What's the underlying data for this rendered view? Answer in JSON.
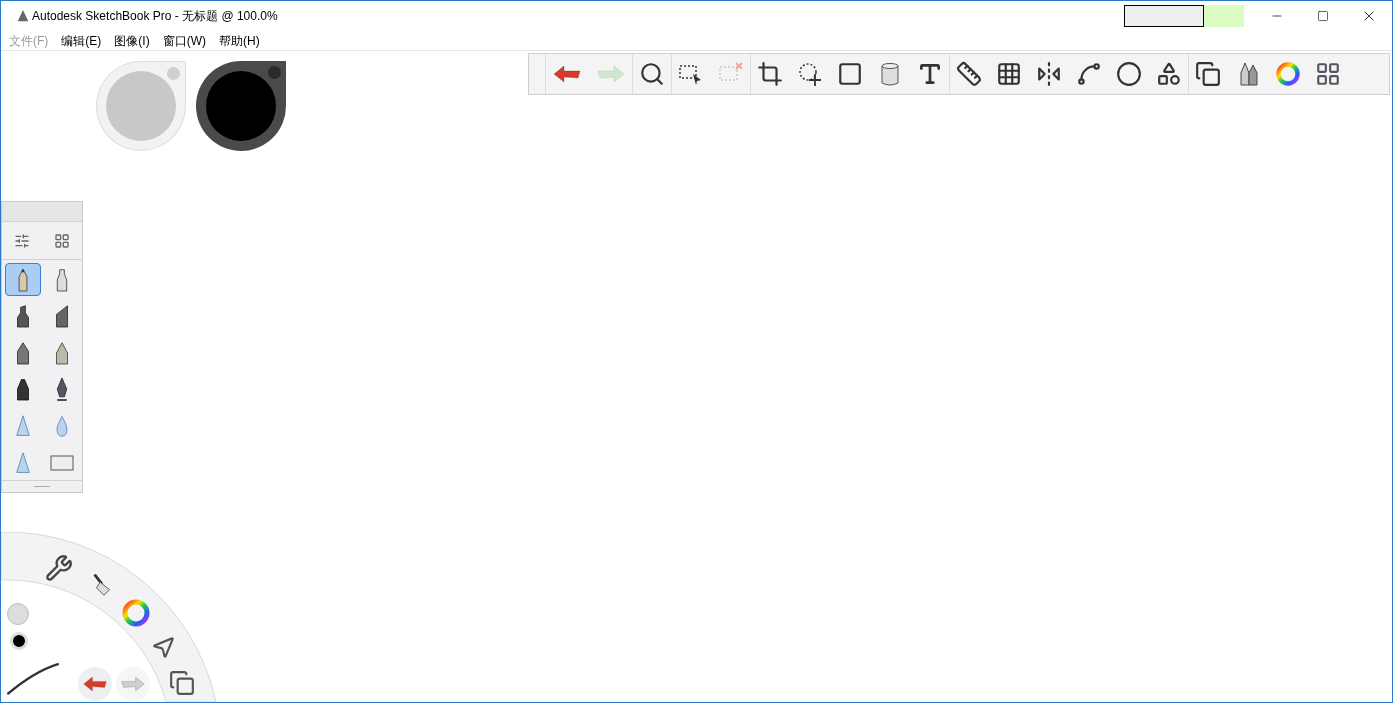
{
  "window": {
    "title": "Autodesk SketchBook Pro - 无标题 @ 100.0%"
  },
  "menu": [
    {
      "label": "文件(F)"
    },
    {
      "label": "编辑(E)"
    },
    {
      "label": "图像(I)"
    },
    {
      "label": "窗口(W)"
    },
    {
      "label": "帮助(H)"
    }
  ],
  "pucks": [
    {
      "color": "#c8c8c8"
    },
    {
      "color": "#000000"
    }
  ],
  "toolbar": {
    "groups": [
      [
        {
          "kind": "undo",
          "disabled": false
        },
        {
          "kind": "redo",
          "disabled": true
        }
      ],
      [
        {
          "kind": "zoom",
          "disabled": false
        }
      ],
      [
        {
          "kind": "select",
          "disabled": false
        },
        {
          "kind": "clear-select",
          "disabled": true
        }
      ],
      [
        {
          "kind": "crop",
          "disabled": false
        },
        {
          "kind": "move",
          "disabled": false
        },
        {
          "kind": "distort",
          "disabled": false
        },
        {
          "kind": "fill",
          "disabled": false
        },
        {
          "kind": "text",
          "disabled": false
        }
      ],
      [
        {
          "kind": "ruler",
          "disabled": false
        },
        {
          "kind": "perspective",
          "disabled": false
        },
        {
          "kind": "symmetry",
          "disabled": false
        },
        {
          "kind": "curve",
          "disabled": false
        },
        {
          "kind": "ellipse",
          "disabled": false
        },
        {
          "kind": "shape",
          "disabled": false
        }
      ],
      [
        {
          "kind": "layers",
          "disabled": false
        },
        {
          "kind": "brushes",
          "disabled": false
        },
        {
          "kind": "color",
          "disabled": false
        },
        {
          "kind": "palettes",
          "disabled": false
        }
      ]
    ]
  },
  "brushes": [
    {
      "kind": "pencil",
      "selected": true
    },
    {
      "kind": "pen",
      "selected": false
    },
    {
      "kind": "marker",
      "selected": false
    },
    {
      "kind": "chisel",
      "selected": false
    },
    {
      "kind": "ballpoint",
      "selected": false
    },
    {
      "kind": "paintbrush",
      "selected": false
    },
    {
      "kind": "felt",
      "selected": false
    },
    {
      "kind": "nib",
      "selected": false
    },
    {
      "kind": "airbrush",
      "selected": false
    },
    {
      "kind": "drop",
      "selected": false
    },
    {
      "kind": "airbrush",
      "selected": false
    },
    {
      "kind": "eraser",
      "selected": false
    }
  ]
}
